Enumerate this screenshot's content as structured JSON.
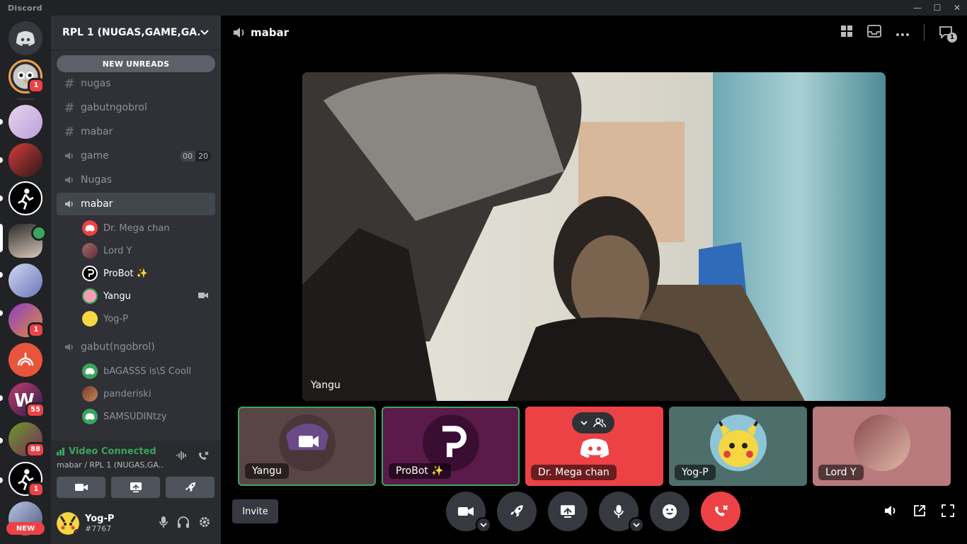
{
  "app": {
    "title": "Discord"
  },
  "window_controls": {
    "minimize": "—",
    "maximize": "☐",
    "close": "✕"
  },
  "servers": {
    "badges": [
      "1",
      "1",
      "55",
      "88",
      "1"
    ],
    "new_label": "NEW"
  },
  "guild": {
    "name": "RPL 1 (NUGAS,GAME,GA..."
  },
  "new_unreads": "NEW UNREADS",
  "channels": [
    {
      "type": "text",
      "name": "nugas"
    },
    {
      "type": "text",
      "name": "gabutngobrol"
    },
    {
      "type": "text",
      "name": "mabar"
    },
    {
      "type": "voice",
      "name": "game",
      "count_a": "00",
      "count_b": "20"
    },
    {
      "type": "voice",
      "name": "Nugas"
    },
    {
      "type": "voice",
      "name": "mabar"
    },
    {
      "type": "voice",
      "name": "gabut(ngobrol)"
    }
  ],
  "mabar_users": [
    {
      "name": "Dr. Mega chan"
    },
    {
      "name": "Lord Y"
    },
    {
      "name": "ProBot ✨"
    },
    {
      "name": "Yangu"
    },
    {
      "name": "Yog-P"
    }
  ],
  "gabut_users": [
    {
      "name": "bAGASSS is\\S Cooll"
    },
    {
      "name": "panderiski"
    },
    {
      "name": "SAMSUDINtzy"
    }
  ],
  "rtc": {
    "status": "Video Connected",
    "location": "mabar / RPL 1 (NUGAS,GA..."
  },
  "user": {
    "name": "Yog-P",
    "tag": "#7767"
  },
  "header": {
    "channel": "mabar",
    "inbox_count": "1"
  },
  "stage": {
    "name": "Yangu"
  },
  "tiles": [
    {
      "name": "Yangu"
    },
    {
      "name": "ProBot ✨"
    },
    {
      "name": "Dr. Mega chan"
    },
    {
      "name": "Yog-P"
    },
    {
      "name": "Lord Y"
    }
  ],
  "invite": "Invite",
  "colors": {
    "accent_green": "#3ba55d",
    "danger": "#ed4245",
    "discord_red": "#ed4245"
  }
}
